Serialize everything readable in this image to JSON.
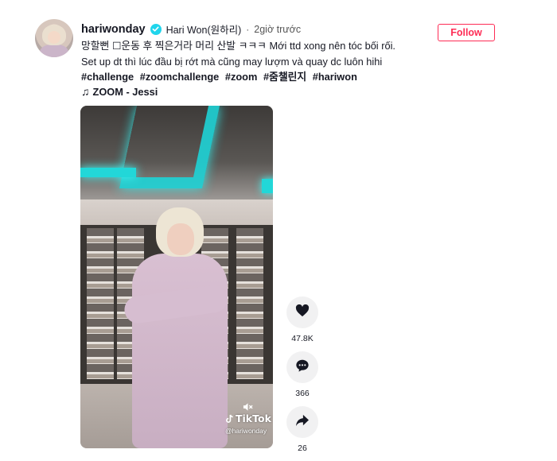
{
  "post": {
    "username": "hariwonday",
    "nickname": "Hari Won(원하리)",
    "separator": "·",
    "time": "2giờ trước",
    "follow_label": "Follow",
    "caption_line1": "망할뻔 ☐운동 후 찍은거라 머리 산발 ㅋㅋㅋ Mới ttd xong nên tóc bối rối.",
    "caption_line2": "Set up dt thì lúc đầu bị rớt mà cũng may lượm và quay dc luôn hihi",
    "hashtags": [
      "#challenge",
      "#zoomchallenge",
      "#zoom",
      "#줌챌린지",
      "#hariwon"
    ],
    "music": "ZOOM - Jessi"
  },
  "video": {
    "watermark_brand": "TikTok",
    "watermark_handle": "@hariwonday"
  },
  "actions": {
    "likes": "47.8K",
    "comments": "366",
    "shares": "26"
  },
  "colors": {
    "accent": "#fe2c55",
    "verified": "#20d5ec",
    "action_bg": "#f1f1f2"
  },
  "icons": [
    "verified-badge-icon",
    "music-note-icon",
    "heart-icon",
    "comment-icon",
    "share-icon",
    "tiktok-logo-icon",
    "mute-icon"
  ]
}
